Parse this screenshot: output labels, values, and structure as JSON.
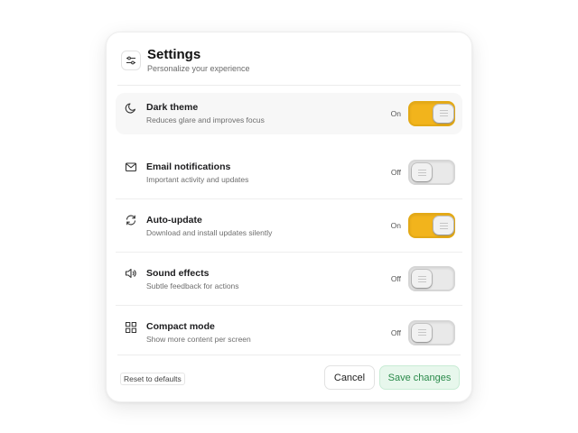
{
  "header": {
    "title": "Settings",
    "subtitle": "Personalize your experience",
    "icon": "sliders-icon"
  },
  "settings": [
    {
      "title": "Dark theme",
      "description": "Reduces glare and improves focus",
      "state": "On",
      "enabled": true,
      "icon": "moon-icon"
    },
    {
      "title": "Email notifications",
      "description": "Important activity and updates",
      "state": "Off",
      "enabled": false,
      "icon": "mail-icon"
    },
    {
      "title": "Auto-update",
      "description": "Download and install updates silently",
      "state": "On",
      "enabled": true,
      "icon": "refresh-icon"
    },
    {
      "title": "Sound effects",
      "description": "Subtle feedback for actions",
      "state": "Off",
      "enabled": false,
      "icon": "speaker-icon"
    },
    {
      "title": "Compact mode",
      "description": "Show more content per screen",
      "state": "Off",
      "enabled": false,
      "icon": "grid-icon"
    }
  ],
  "footer": {
    "reset_label": "Reset to defaults",
    "cancel_label": "Cancel",
    "save_label": "Save changes"
  },
  "colors": {
    "toggle_on": "#f2b41c",
    "toggle_off": "#e9e9e9",
    "save_bg": "#e7f7ec",
    "save_text": "#2a8a4a"
  }
}
